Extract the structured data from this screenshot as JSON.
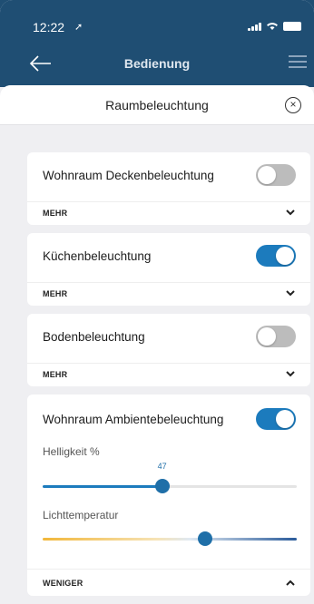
{
  "status_bar": {
    "time": "12:22"
  },
  "nav": {
    "title": "Bedienung"
  },
  "sheet": {
    "title": "Raumbeleuchtung"
  },
  "lights": [
    {
      "label": "Wohnraum Deckenbeleuchtung",
      "on": false,
      "toggle_label": "MEHR"
    },
    {
      "label": "Küchenbeleuchtung",
      "on": true,
      "toggle_label": "MEHR"
    },
    {
      "label": "Bodenbeleuchtung",
      "on": false,
      "toggle_label": "MEHR"
    },
    {
      "label": "Wohnraum Ambientebeleuchtung",
      "on": true,
      "toggle_label": "WENIGER",
      "brightness": {
        "label": "Helligkeit %",
        "value": 47
      },
      "temperature": {
        "label": "Lichttemperatur",
        "level": 0.64
      }
    }
  ],
  "colors": {
    "header_bg": "#1f4e73",
    "accent": "#1c7bbd",
    "toggle_off": "#bcbcbc",
    "temp_warm": "#f2b73a",
    "temp_cool": "#2a5b9a"
  },
  "icons": {
    "back": "arrow-left-icon",
    "menu": "hamburger-menu-icon",
    "close": "close-circle-icon",
    "expand": "chevron-down-icon",
    "collapse": "chevron-up-icon"
  }
}
